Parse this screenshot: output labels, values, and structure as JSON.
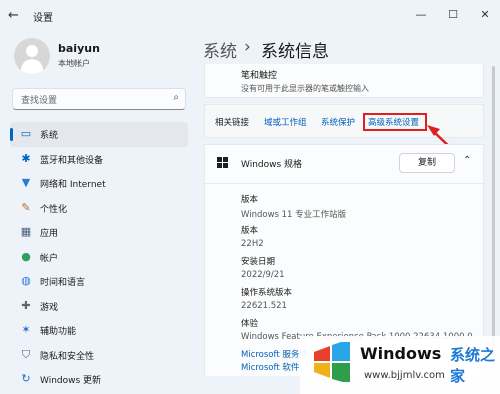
{
  "window": {
    "title": "设置",
    "back_icon": "back-arrow-icon",
    "min": "—",
    "max": "☐",
    "close": "✕"
  },
  "user": {
    "name": "baiyun",
    "account_type": "本地帐户"
  },
  "search": {
    "placeholder": "查找设置"
  },
  "nav": {
    "items": [
      {
        "label": "系统",
        "icon": "monitor-icon"
      },
      {
        "label": "蓝牙和其他设备",
        "icon": "bluetooth-icon"
      },
      {
        "label": "网络和 Internet",
        "icon": "wifi-icon"
      },
      {
        "label": "个性化",
        "icon": "brush-icon"
      },
      {
        "label": "应用",
        "icon": "apps-icon"
      },
      {
        "label": "帐户",
        "icon": "person-icon"
      },
      {
        "label": "时间和语言",
        "icon": "globe-clock-icon"
      },
      {
        "label": "游戏",
        "icon": "gamepad-icon"
      },
      {
        "label": "辅助功能",
        "icon": "accessibility-icon"
      },
      {
        "label": "隐私和安全性",
        "icon": "shield-icon"
      },
      {
        "label": "Windows 更新",
        "icon": "update-icon"
      }
    ],
    "active_index": 0
  },
  "header": {
    "crumb_parent": "系统",
    "separator": "›",
    "crumb_current": "系统信息"
  },
  "pen": {
    "title": "笔和触控",
    "description": "没有可用于此显示器的笔或触控输入"
  },
  "related": {
    "label": "相关链接",
    "links": [
      "域或工作组",
      "系统保护",
      "高级系统设置"
    ],
    "highlighted": "高级系统设置"
  },
  "spec": {
    "title": "Windows 规格",
    "copy_label": "复制",
    "rows": [
      {
        "key": "版本",
        "value": "Windows 11 专业工作站版"
      },
      {
        "key": "版本",
        "value": "22H2"
      },
      {
        "key": "安装日期",
        "value": "2022/9/21"
      },
      {
        "key": "操作系统版本",
        "value": "22621.521"
      },
      {
        "key": "体验",
        "value": "Windows Feature Experience Pack 1000.22634.1000.0"
      }
    ],
    "links": [
      "Microsoft 服务协",
      "Microsoft 软件"
    ]
  },
  "watermark": {
    "brand": "Windows",
    "sub": "系统之家",
    "url": "www.bjjmlv.com"
  },
  "colors": {
    "accent": "#0067c0",
    "link": "#0060b8",
    "highlight": "#e02020"
  }
}
